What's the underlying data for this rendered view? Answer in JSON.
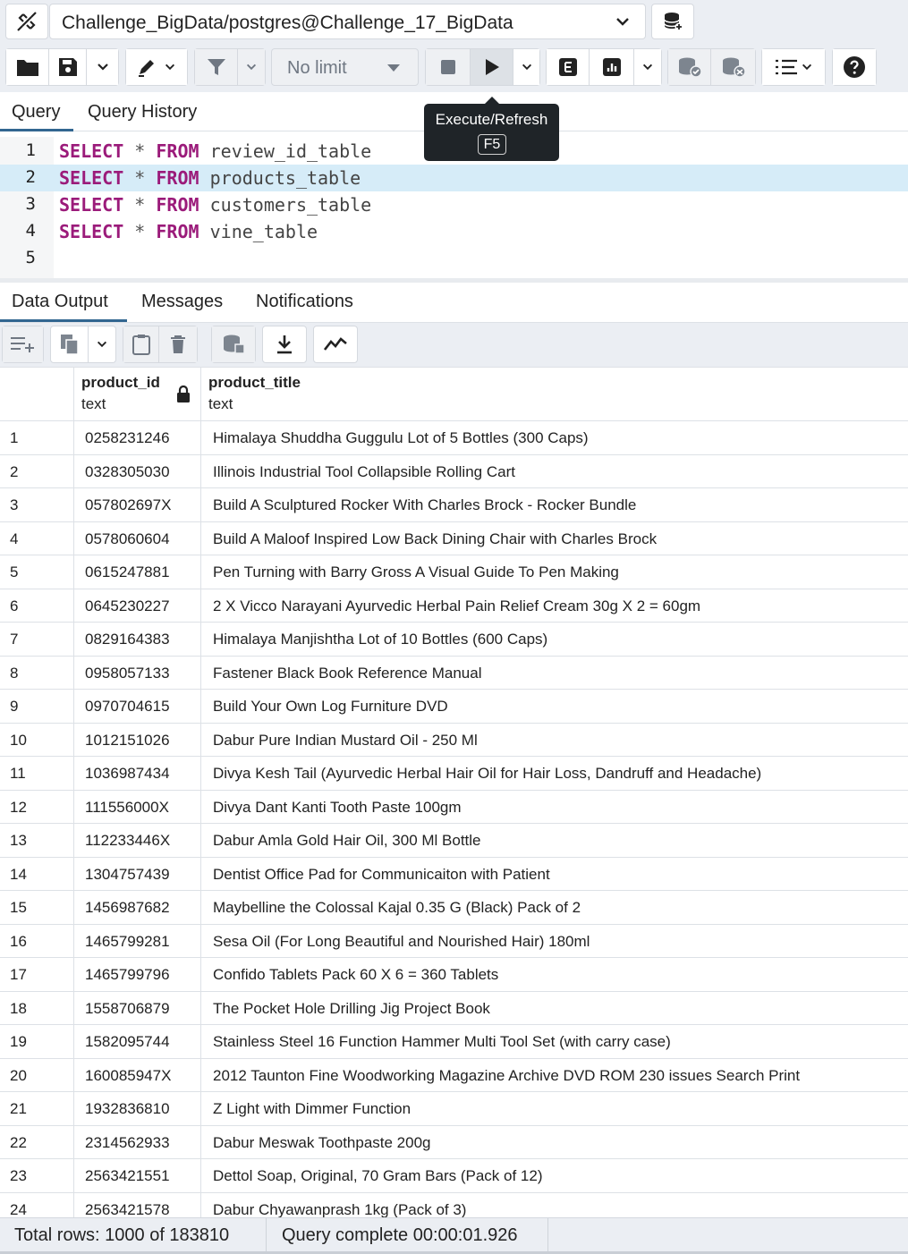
{
  "connection": {
    "label": "Challenge_BigData/postgres@Challenge_17_BigData"
  },
  "toolbar": {
    "limit_value": "No limit",
    "icons": [
      "open-file-icon",
      "save-icon",
      "chevron-down-icon",
      "edit-pen-icon",
      "filter-icon",
      "stop-icon",
      "execute-play-icon",
      "explain-icon",
      "explain-analyze-icon",
      "commit-icon",
      "rollback-icon",
      "macros-icon",
      "help-icon"
    ]
  },
  "query_tabs": [
    "Query",
    "Query History"
  ],
  "tooltip": {
    "title": "Execute/Refresh",
    "shortcut": "F5"
  },
  "editor": {
    "lines": [
      {
        "num": "1",
        "kw1": "SELECT",
        "op": "*",
        "kw2": "FROM",
        "table": "review_id_table"
      },
      {
        "num": "2",
        "kw1": "SELECT",
        "op": "*",
        "kw2": "FROM",
        "table": "products_table"
      },
      {
        "num": "3",
        "kw1": "SELECT",
        "op": "*",
        "kw2": "FROM",
        "table": "customers_table"
      },
      {
        "num": "4",
        "kw1": "SELECT",
        "op": "*",
        "kw2": "FROM",
        "table": "vine_table"
      },
      {
        "num": "5",
        "kw1": "",
        "op": "",
        "kw2": "",
        "table": ""
      }
    ],
    "highlighted_line": 2
  },
  "output_tabs": [
    "Data Output",
    "Messages",
    "Notifications"
  ],
  "grid": {
    "columns": [
      {
        "name": "product_id",
        "type": "text",
        "locked": true
      },
      {
        "name": "product_title",
        "type": "text",
        "locked": false
      }
    ],
    "rows": [
      [
        "1",
        "0258231246",
        "Himalaya Shuddha Guggulu Lot of 5 Bottles (300 Caps)"
      ],
      [
        "2",
        "0328305030",
        "Illinois Industrial Tool Collapsible Rolling Cart"
      ],
      [
        "3",
        "057802697X",
        "Build A Sculptured Rocker With Charles Brock - Rocker Bundle"
      ],
      [
        "4",
        "0578060604",
        "Build A Maloof Inspired Low Back Dining Chair with Charles Brock"
      ],
      [
        "5",
        "0615247881",
        "Pen Turning with Barry Gross A Visual Guide To Pen Making"
      ],
      [
        "6",
        "0645230227",
        "2 X Vicco Narayani Ayurvedic Herbal Pain Relief Cream 30g X 2 = 60gm"
      ],
      [
        "7",
        "0829164383",
        "Himalaya Manjishtha Lot of 10 Bottles (600 Caps)"
      ],
      [
        "8",
        "0958057133",
        "Fastener Black Book Reference Manual"
      ],
      [
        "9",
        "0970704615",
        "Build Your Own Log Furniture DVD"
      ],
      [
        "10",
        "1012151026",
        "Dabur Pure Indian Mustard Oil - 250 Ml"
      ],
      [
        "11",
        "1036987434",
        "Divya Kesh Tail (Ayurvedic Herbal Hair Oil for Hair Loss, Dandruff and Headache)"
      ],
      [
        "12",
        "111556000X",
        "Divya Dant Kanti Tooth Paste 100gm"
      ],
      [
        "13",
        "112233446X",
        "Dabur Amla Gold Hair Oil, 300 Ml Bottle"
      ],
      [
        "14",
        "1304757439",
        "Dentist Office Pad for Communicaiton with Patient"
      ],
      [
        "15",
        "1456987682",
        "Maybelline the Colossal Kajal 0.35 G (Black) Pack of 2"
      ],
      [
        "16",
        "1465799281",
        "Sesa Oil (For Long Beautiful and Nourished Hair) 180ml"
      ],
      [
        "17",
        "1465799796",
        "Confido Tablets Pack 60 X 6 = 360 Tablets"
      ],
      [
        "18",
        "1558706879",
        "The Pocket Hole Drilling Jig Project Book"
      ],
      [
        "19",
        "1582095744",
        "Stainless Steel 16 Function Hammer Multi Tool Set (with carry case)"
      ],
      [
        "20",
        "160085947X",
        "2012 Taunton Fine Woodworking Magazine Archive DVD ROM 230 issues Search Print"
      ],
      [
        "21",
        "1932836810",
        "Z Light with Dimmer Function"
      ],
      [
        "22",
        "2314562933",
        "Dabur Meswak Toothpaste 200g"
      ],
      [
        "23",
        "2563421551",
        "Dettol Soap, Original, 70 Gram Bars (Pack of 12)"
      ],
      [
        "24",
        "2563421578",
        "Dabur Chyawanprash 1kg (Pack of 3)"
      ]
    ]
  },
  "status": {
    "total_rows": "Total rows: 1000 of 183810",
    "query_complete": "Query complete 00:00:01.926"
  },
  "colors": {
    "accent": "#326690",
    "keyword": "#9b1b7a",
    "highlight_line": "#d6ecf8",
    "toolbar_bg": "#ebeef3"
  }
}
